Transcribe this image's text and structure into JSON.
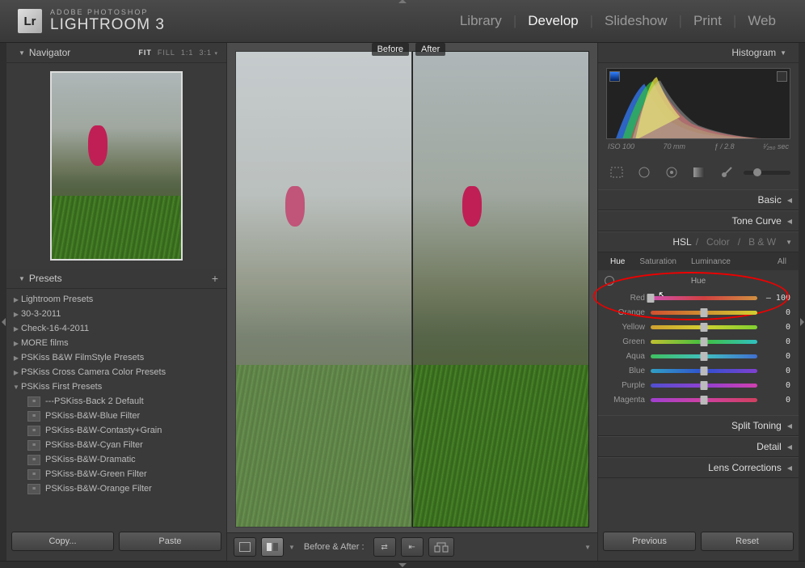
{
  "brand": {
    "logo": "Lr",
    "line1": "ADOBE PHOTOSHOP",
    "line2": "LIGHTROOM 3"
  },
  "modules": {
    "library": "Library",
    "develop": "Develop",
    "slideshow": "Slideshow",
    "print": "Print",
    "web": "Web"
  },
  "navigator": {
    "title": "Navigator",
    "opts_fit": "FIT",
    "opts_fill": "FILL",
    "opts_11": "1:1",
    "opts_31": "3:1"
  },
  "presets": {
    "title": "Presets",
    "folders": [
      {
        "label": "Lightroom Presets"
      },
      {
        "label": "30-3-2011"
      },
      {
        "label": "Check-16-4-2011"
      },
      {
        "label": "MORE films"
      },
      {
        "label": "PSKiss B&W FilmStyle Presets"
      },
      {
        "label": "PSKiss Cross Camera Color Presets"
      },
      {
        "label": "PSKiss First Presets",
        "open": true
      }
    ],
    "items": [
      "---PSKiss-Back 2 Default",
      "PSKiss-B&W-Blue Filter",
      "PSKiss-B&W-Contasty+Grain",
      "PSKiss-B&W-Cyan Filter",
      "PSKiss-B&W-Dramatic",
      "PSKiss-B&W-Green Filter",
      "PSKiss-B&W-Orange Filter"
    ]
  },
  "buttons": {
    "copy": "Copy...",
    "paste": "Paste",
    "previous": "Previous",
    "reset": "Reset"
  },
  "compare": {
    "before": "Before",
    "after": "After",
    "label": "Before & After :"
  },
  "histogram": {
    "title": "Histogram",
    "iso": "ISO 100",
    "focal": "70 mm",
    "aperture": "ƒ / 2.8",
    "shutter_html": "¹⁄₂₅₀ sec"
  },
  "sections": {
    "basic": "Basic",
    "tone": "Tone Curve",
    "split": "Split Toning",
    "detail": "Detail",
    "lens": "Lens Corrections"
  },
  "hsl": {
    "tab_hsl": "HSL",
    "tab_color": "Color",
    "tab_bw": "B & W",
    "sub_hue": "Hue",
    "sub_sat": "Saturation",
    "sub_lum": "Luminance",
    "sub_all": "All",
    "title": "Hue",
    "rows": [
      {
        "name": "Red",
        "value": "– 100",
        "pos": 0,
        "grad": "linear-gradient(90deg,#d050b0,#d04040,#d09040)"
      },
      {
        "name": "Orange",
        "value": "0",
        "pos": 50,
        "grad": "linear-gradient(90deg,#d05030,#d09030,#d0d030)"
      },
      {
        "name": "Yellow",
        "value": "0",
        "pos": 50,
        "grad": "linear-gradient(90deg,#d0a030,#d0d030,#80d030)"
      },
      {
        "name": "Green",
        "value": "0",
        "pos": 50,
        "grad": "linear-gradient(90deg,#c0c030,#40c040,#30c0c0)"
      },
      {
        "name": "Aqua",
        "value": "0",
        "pos": 50,
        "grad": "linear-gradient(90deg,#40c060,#40c0c0,#4070d0)"
      },
      {
        "name": "Blue",
        "value": "0",
        "pos": 50,
        "grad": "linear-gradient(90deg,#30a0c4,#3050d0,#8040d0)"
      },
      {
        "name": "Purple",
        "value": "0",
        "pos": 50,
        "grad": "linear-gradient(90deg,#5050d0,#9040d0,#d040b0)"
      },
      {
        "name": "Magenta",
        "value": "0",
        "pos": 50,
        "grad": "linear-gradient(90deg,#a040d0,#d040a0,#d04060)"
      }
    ]
  }
}
